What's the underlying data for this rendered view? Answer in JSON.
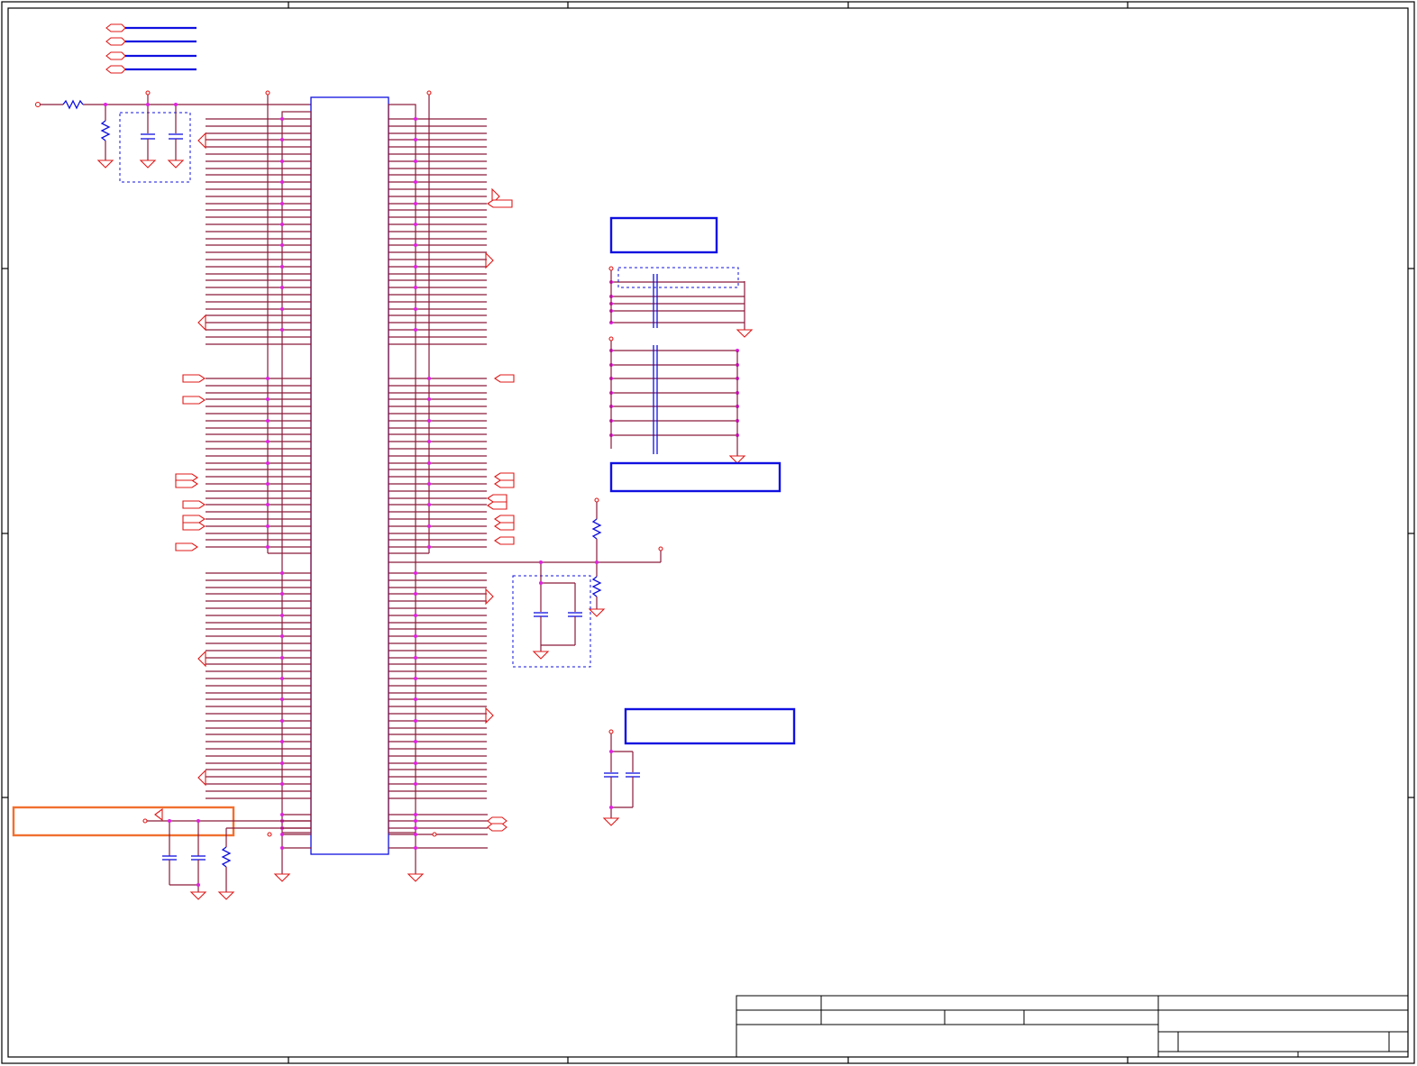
{
  "schematic": {
    "sheet_title": "",
    "drawing_number": "",
    "revision": "",
    "note_boxes": [
      "",
      "",
      "",
      ""
    ]
  },
  "colors": {
    "wire": "#8b1a3a",
    "bus": "#1010e0",
    "port": "#e01818",
    "junction": "#e020e0",
    "frame": "#000000",
    "highlight": "#f07030"
  }
}
